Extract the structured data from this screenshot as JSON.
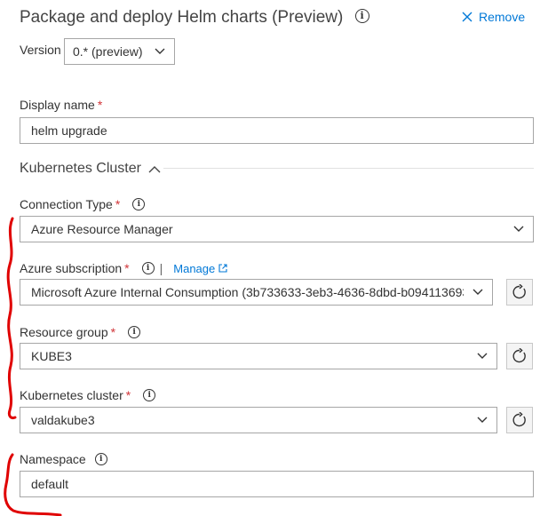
{
  "header": {
    "title": "Package and deploy Helm charts (Preview)",
    "remove_label": "Remove"
  },
  "version": {
    "label": "Version",
    "selected": "0.* (preview)"
  },
  "display_name": {
    "label": "Display name",
    "required": "*",
    "value": "helm upgrade"
  },
  "kubernetes_section": {
    "title": "Kubernetes Cluster"
  },
  "connection_type": {
    "label": "Connection Type",
    "required": "*",
    "selected": "Azure Resource Manager"
  },
  "azure_subscription": {
    "label": "Azure subscription",
    "required": "*",
    "separator": "|",
    "manage_label": "Manage",
    "selected": "Microsoft Azure Internal Consumption (3b733633-3eb3-4636-8dbd-b094113693"
  },
  "resource_group": {
    "label": "Resource group",
    "required": "*",
    "selected": "KUBE3"
  },
  "kubernetes_cluster": {
    "label": "Kubernetes cluster",
    "required": "*",
    "selected": "valdakube3"
  },
  "namespace": {
    "label": "Namespace",
    "value": "default"
  },
  "colors": {
    "accent": "#0078d7",
    "required": "#d13438",
    "annotation": "#e00000",
    "border": "#a6a6a6"
  }
}
